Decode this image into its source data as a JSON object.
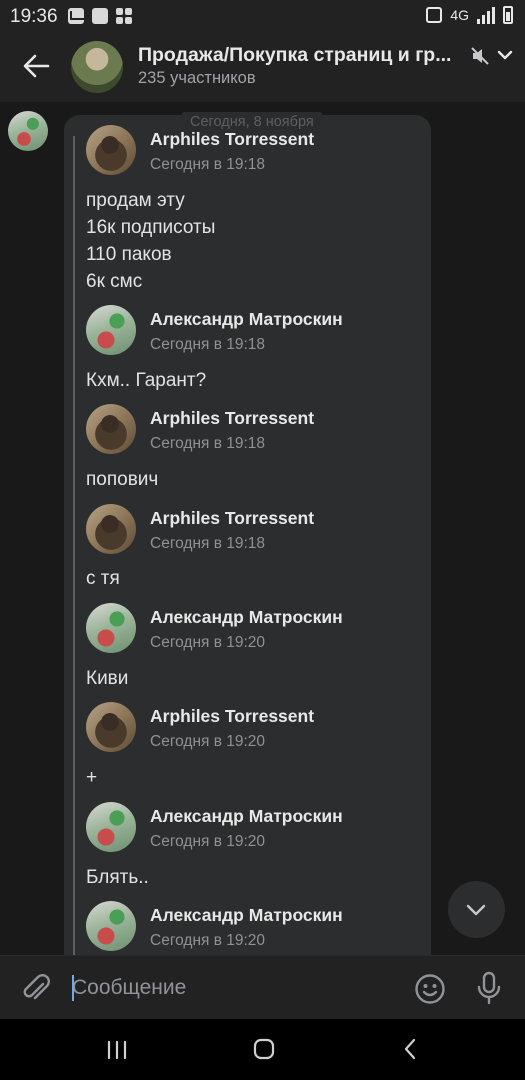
{
  "status_bar": {
    "time": "19:36",
    "network": "4G"
  },
  "chat": {
    "title": "Продажа/Покупка страниц и гр...",
    "subtitle": "235 участников"
  },
  "date_chip": "Сегодня, 8 ноября",
  "messages": [
    {
      "author": "Arphiles Torressent",
      "time": "Сегодня в 19:18",
      "lines": [
        "продам эту",
        "16к подписоты",
        "110 паков",
        "6к смс"
      ]
    },
    {
      "author": "Александр Матроскин",
      "time": "Сегодня в 19:18",
      "lines": [
        "Кхм.. Гарант?"
      ]
    },
    {
      "author": "Arphiles Torressent",
      "time": "Сегодня в 19:18",
      "lines": [
        "попович"
      ]
    },
    {
      "author": "Arphiles Torressent",
      "time": "Сегодня в 19:18",
      "lines": [
        "с тя"
      ]
    },
    {
      "author": "Александр Матроскин",
      "time": "Сегодня в 19:20",
      "lines": [
        "Киви"
      ]
    },
    {
      "author": "Arphiles Torressent",
      "time": "Сегодня в 19:20",
      "lines": [
        "+"
      ]
    },
    {
      "author": "Александр Матроскин",
      "time": "Сегодня в 19:20",
      "lines": [
        "Блять.."
      ]
    },
    {
      "author": "Александр Матроскин",
      "time": "Сегодня в 19:20",
      "lines": []
    }
  ],
  "composer": {
    "placeholder": "Сообщение"
  },
  "colors": {
    "accent": "#71aaeb",
    "background": "#19191a",
    "bubble": "#2c2d2e"
  }
}
